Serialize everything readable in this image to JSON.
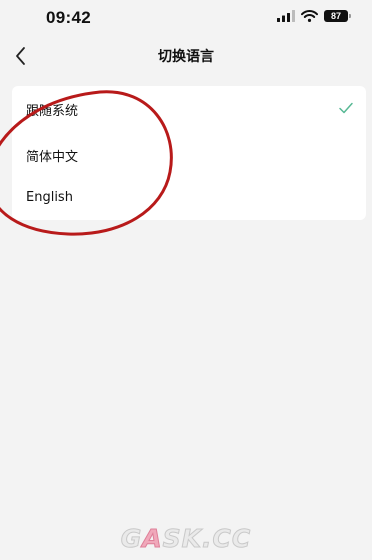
{
  "status_bar": {
    "time": "09:42",
    "battery": "87",
    "icons": [
      "signal-icon",
      "wifi-icon",
      "battery-icon"
    ]
  },
  "nav": {
    "title": "切换语言",
    "back_icon": "chevron-left-icon"
  },
  "languages": [
    {
      "label": "跟随系统",
      "selected": true
    },
    {
      "label": "简体中文",
      "selected": false
    },
    {
      "label": "English",
      "selected": false
    }
  ],
  "colors": {
    "check": "#57b894",
    "annotation": "#b81a1a",
    "watermark_accent": "#e27f98"
  },
  "watermark": {
    "part1": "G",
    "part2": "A",
    "part3": "SK.CC"
  }
}
